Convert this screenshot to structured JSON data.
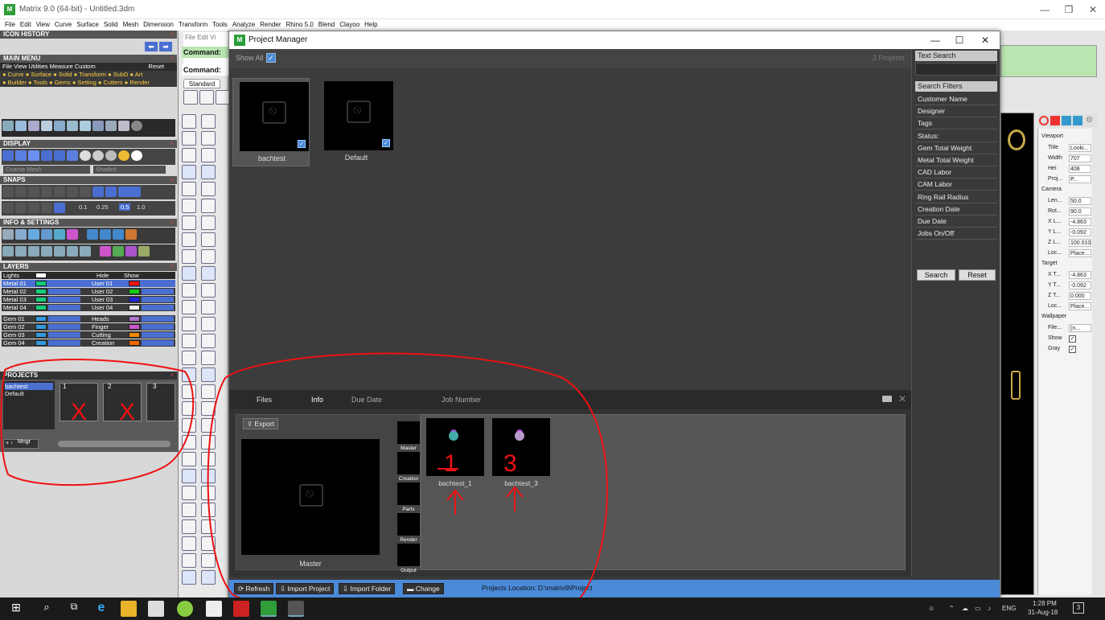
{
  "window": {
    "title": "Matrix 9.0 (64-bit) - Untitled.3dm",
    "min": "—",
    "max": "❐",
    "close": "✕"
  },
  "menubar": [
    "File",
    "Edit",
    "View",
    "Curve",
    "Surface",
    "Solid",
    "Mesh",
    "Dimension",
    "Transform",
    "Tools",
    "Analyze",
    "Render",
    "Rhino 5.0",
    "Blend",
    "Clayoo",
    "Help"
  ],
  "left": {
    "icon_history": "ICON HISTORY",
    "main_menu": "MAIN MENU",
    "main_menu_row1": "File  View  Utilities  Measure  Custom",
    "main_menu_reset": "Reset",
    "main_menu_row2": "● Curve ● Surface ● Solid ● Transform ● SubD   ● Art",
    "main_menu_row3": "● Builder ● Tools ● Gems ● Setting ● Cutters ● Render",
    "display": "DISPLAY",
    "display_mesh": "Coarse Mesh",
    "display_shaded": "Shaded",
    "snaps": "SNAPS",
    "snap_values": [
      "0.1",
      "0.25",
      "0.5",
      "1.0"
    ],
    "info_settings": "INFO & SETTINGS",
    "layers": "LAYERS",
    "lights": "Lights",
    "hide": "Hide",
    "show": "Show",
    "layer_left": [
      "Metal 01",
      "Metal 02",
      "Metal 03",
      "Metal 04",
      "Gem 01",
      "Gem 02",
      "Gem 03",
      "Gem 04"
    ],
    "layer_right": [
      "User 01",
      "User 02",
      "User 03",
      "User 04",
      "Heads",
      "Finger",
      "Cutting",
      "Creation"
    ],
    "layer_right_colors": [
      "#e11",
      "#1c1",
      "#22d",
      "#eee",
      "#a7c",
      "#c5c",
      "#e80",
      "#e60"
    ],
    "projects": "PROJECTS",
    "project_list": [
      "bachtest",
      "Default"
    ],
    "slot_labels": [
      "1",
      "2",
      "3"
    ],
    "mngr": "Mngr"
  },
  "rhino": {
    "cmd_history": "File  Edit  Vi",
    "command_label1": "Command:",
    "command_label2": "Command:",
    "standard_tab": "Standard"
  },
  "properties": {
    "viewport": "Viewport",
    "rows": [
      {
        "k": "Title",
        "v": "Looki..."
      },
      {
        "k": "Width",
        "v": "707"
      },
      {
        "k": "Hei",
        "v": "408"
      },
      {
        "k": "Proj...",
        "v": "P..."
      }
    ],
    "camera": "Camera",
    "camera_rows": [
      {
        "k": "Len...",
        "v": "50.0"
      },
      {
        "k": "Rot...",
        "v": "90.0"
      },
      {
        "k": "X L...",
        "v": "-4.863"
      },
      {
        "k": "Y L...",
        "v": "-0.092"
      },
      {
        "k": "Z L...",
        "v": "100.010"
      },
      {
        "k": "Loc...",
        "v": "Place..."
      }
    ],
    "target": "Target",
    "target_rows": [
      {
        "k": "X T...",
        "v": "-4.863"
      },
      {
        "k": "Y T...",
        "v": "-0.092"
      },
      {
        "k": "Z T...",
        "v": "0.000"
      },
      {
        "k": "Loc...",
        "v": "Place..."
      }
    ],
    "wallpaper": "Wallpaper",
    "wall_file": "File...",
    "wall_file_v": "(n...",
    "wall_show": "Show",
    "wall_gray": "Gray"
  },
  "pm": {
    "title": "Project Manager",
    "show_all": "Show All",
    "project_count": "2 Projects",
    "projects": [
      {
        "name": "bachtest",
        "selected": true
      },
      {
        "name": "Default",
        "selected": false
      }
    ],
    "text_search": "Text Search",
    "search_filters": "Search Filters",
    "filters": [
      "Customer Name",
      "Designer",
      "Tags",
      "Status:",
      "Gem Total Weight",
      "Metal Total Weight",
      "CAD Labor",
      "CAM Labor",
      "Ring Rail Radius",
      "Creation Date",
      "Due Date",
      "Jobs On/Off"
    ],
    "search_btn": "Search",
    "reset_btn": "Reset",
    "tabs": [
      "Files",
      "Info",
      "Due Date",
      "Job Number"
    ],
    "export": "Export",
    "master_label": "Master",
    "stages": [
      "Master",
      "Creation",
      "Parts",
      "Render",
      "Output"
    ],
    "files": [
      "bachtest_1",
      "bachtest_3"
    ],
    "status_buttons": [
      "Refresh",
      "Import Project",
      "Import Folder",
      "Change"
    ],
    "location": "Projects Location:  D:\\matrix9\\Project"
  },
  "annotations": {
    "n1": "1",
    "n3": "3",
    "x": "X"
  },
  "taskbar": {
    "time": "1:28 PM",
    "date": "31-Aug-18",
    "lang": "ENG"
  }
}
